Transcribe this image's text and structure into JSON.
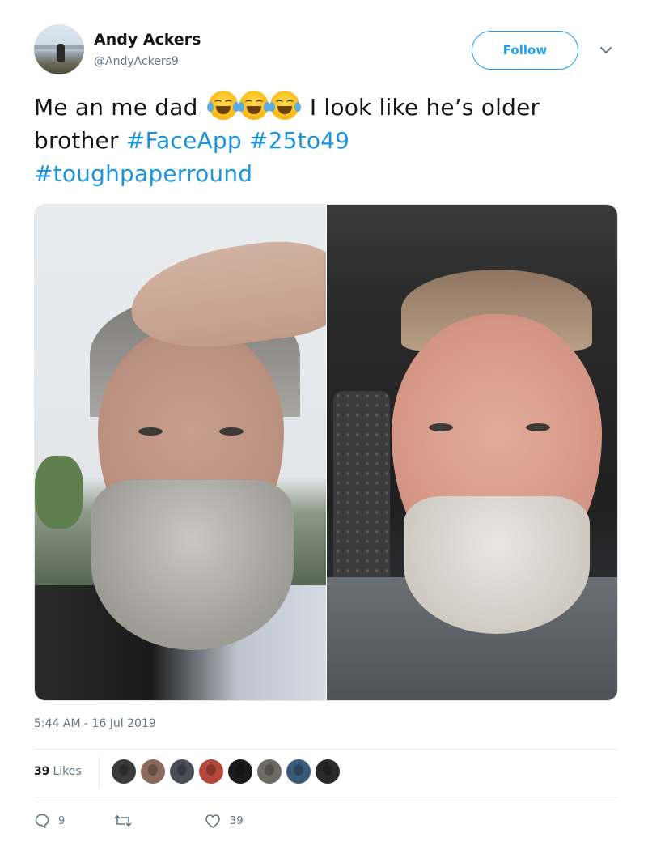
{
  "tweet": {
    "author_name": "Andy Ackers",
    "author_handle": "@AndyAckers9",
    "follow_label": "Follow",
    "text_before_emoji": "Me an me dad",
    "emoji_count": 3,
    "text_after_emoji": "I look like he’s older brother",
    "hashtags": [
      "#FaceApp",
      "#25to49",
      "#toughpaperround"
    ],
    "timestamp": "5:44 AM - 16 Jul 2019",
    "likes_count": "39",
    "likes_label": "Likes",
    "reply_count": "9",
    "retweet_count": "",
    "like_count_action": "39"
  },
  "icons": {
    "caret": "chevron-down-icon",
    "reply": "reply-icon",
    "retweet": "retweet-icon",
    "like": "heart-icon"
  },
  "colors": {
    "accent": "#1da1f2",
    "hashtag": "#1b95e0",
    "muted": "#657786",
    "text": "#14171a",
    "border": "#e6ecf0"
  },
  "likers": [
    {
      "color": "#3b3b3b"
    },
    {
      "color": "#8a6a5a"
    },
    {
      "color": "#4a4f57"
    },
    {
      "color": "#b5483c"
    },
    {
      "color": "#1a1a1a"
    },
    {
      "color": "#6e6a66"
    },
    {
      "color": "#3a5a7a"
    },
    {
      "color": "#2a2a2a"
    }
  ]
}
